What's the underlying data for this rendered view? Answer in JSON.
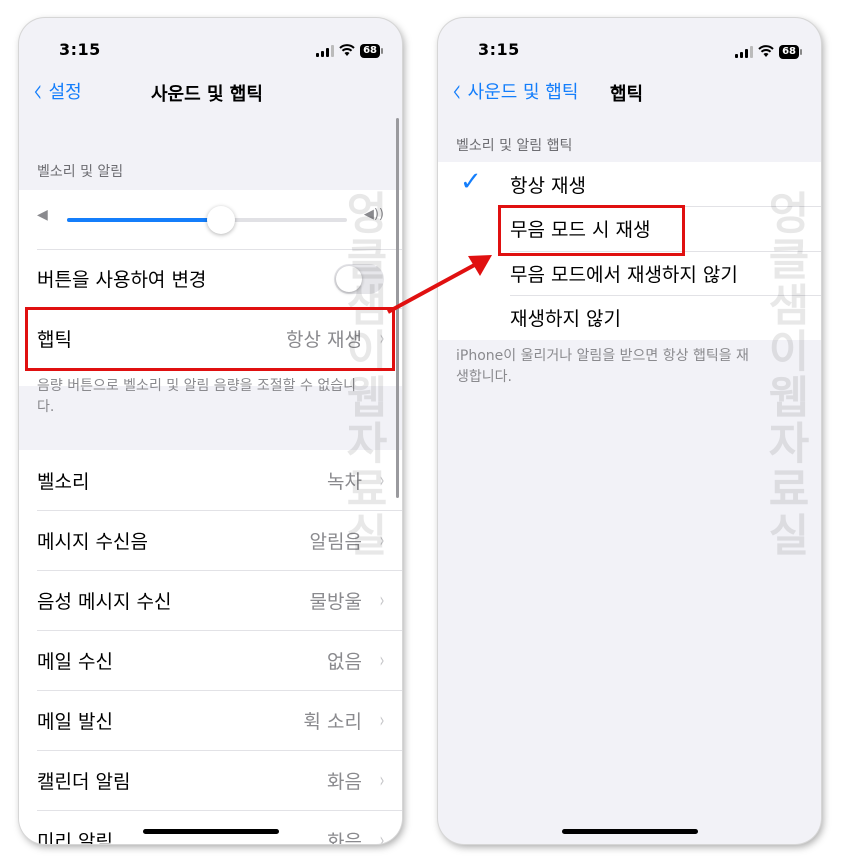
{
  "status": {
    "time": "3:15",
    "battery": "68"
  },
  "left": {
    "back_label": "설정",
    "title": "사운드 및 햅틱",
    "section_header": "벨소리 및 알림",
    "toggle_label": "버튼을 사용하여 변경",
    "haptic_label": "햅틱",
    "haptic_value": "항상 재생",
    "footer": "음량 버튼으로 벨소리 및 알림 음량을 조절할 수 없습니다.",
    "volume_level": 0.55,
    "sounds": [
      {
        "label": "벨소리",
        "value": "녹차"
      },
      {
        "label": "메시지 수신음",
        "value": "알림음"
      },
      {
        "label": "음성 메시지 수신",
        "value": "물방울"
      },
      {
        "label": "메일 수신",
        "value": "없음"
      },
      {
        "label": "메일 발신",
        "value": "휙 소리"
      },
      {
        "label": "캘린더 알림",
        "value": "화음"
      },
      {
        "label": "미리 알림",
        "value": "화음"
      }
    ]
  },
  "right": {
    "back_label": "사운드 및 햅틱",
    "title": "햅틱",
    "section_header": "벨소리 및 알림 햅틱",
    "options": [
      {
        "label": "항상 재생",
        "selected": true
      },
      {
        "label": "무음 모드 시 재생",
        "selected": false
      },
      {
        "label": "무음 모드에서 재생하지 않기",
        "selected": false
      },
      {
        "label": "재생하지 않기",
        "selected": false
      }
    ],
    "footer": "iPhone이 울리거나 알림을 받으면 항상 햅틱을 재생합니다."
  },
  "watermark": "엉클샘이웹자료실",
  "colors": {
    "accent": "#147efb",
    "highlight": "#e01010"
  }
}
